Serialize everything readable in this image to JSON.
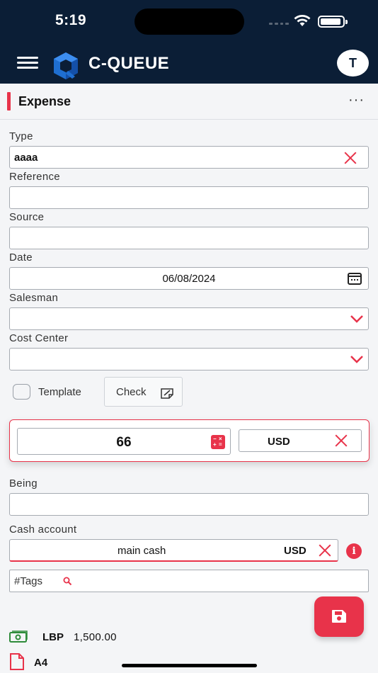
{
  "status_bar": {
    "time": "5:19"
  },
  "header": {
    "app_name": "C-QUEUE",
    "avatar_initial": "T",
    "background": "#0b1e36"
  },
  "page": {
    "title": "Expense",
    "more_label": "···"
  },
  "form": {
    "type": {
      "label": "Type",
      "value": "aaaa"
    },
    "reference": {
      "label": "Reference",
      "value": ""
    },
    "source": {
      "label": "Source",
      "value": ""
    },
    "date": {
      "label": "Date",
      "value": "06/08/2024"
    },
    "salesman": {
      "label": "Salesman",
      "value": ""
    },
    "cost_center": {
      "label": "Cost Center",
      "value": ""
    },
    "template": {
      "label": "Template",
      "checked": false
    },
    "check_button": {
      "label": "Check"
    },
    "amount": {
      "value": "66"
    },
    "currency": {
      "value": "USD"
    },
    "being": {
      "label": "Being",
      "value": ""
    },
    "cash_account": {
      "label": "Cash account",
      "value": "main cash",
      "currency": "USD"
    },
    "tags": {
      "label": "#Tags"
    }
  },
  "footer": {
    "balance_currency": "LBP",
    "balance_amount": "1,500.00",
    "paper_size": "A4"
  },
  "icons": [
    "menu-icon",
    "logo-icon",
    "more-icon",
    "clear-icon",
    "calendar-icon",
    "chevron-down-icon",
    "edit-note-icon",
    "calculator-icon",
    "info-icon",
    "search-icon",
    "save-icon",
    "money-icon",
    "document-icon"
  ],
  "colors": {
    "accent": "#e8334a",
    "header": "#0b1e36",
    "background": "#f4f5f7"
  }
}
